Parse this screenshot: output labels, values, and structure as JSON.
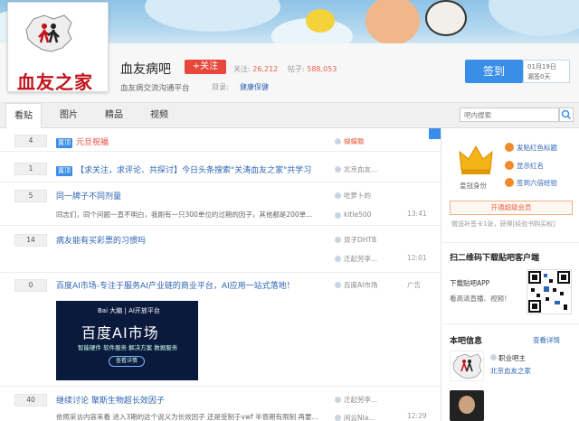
{
  "forum": {
    "name": "血友病吧",
    "follow_label": "+关注",
    "followers_label": "关注:",
    "followers_value": "26,212",
    "posts_label": "帖子:",
    "posts_value": "588,053",
    "description": "血友病交流沟通平台",
    "category_label": "目录:",
    "category_value": "健康保健",
    "logo_text": "血友之家"
  },
  "signin": {
    "button_label": "签到",
    "date": "01月19日",
    "days": "漏签0天"
  },
  "tabs": [
    {
      "label": "看贴",
      "active": true
    },
    {
      "label": "图片",
      "active": false
    },
    {
      "label": "精品",
      "active": false
    },
    {
      "label": "视频",
      "active": false
    }
  ],
  "search": {
    "placeholder": "吧内搜索"
  },
  "threads": [
    {
      "replies": "4",
      "tag": "置顶",
      "title": "元旦祝福",
      "author": "蝴蝶飘",
      "excerpt": "",
      "time": ""
    },
    {
      "replies": "1",
      "tag": "置顶",
      "title": "【求关注，求评论、共探讨】今日头条搜索\"关涛血友之家\"共学习",
      "author": "北京血友...",
      "excerpt": "",
      "time": ""
    },
    {
      "replies": "5",
      "tag": "",
      "title": "同一牌子不同剂量",
      "author": "吃萝卜的",
      "excerpt": "同志们，同个问题一直不明白，我刚有一只300单位的过期的因子，其他都是200单...",
      "last": "kitle500",
      "time": "13:41"
    },
    {
      "replies": "14",
      "tag": "",
      "title": "病友能有买彩票的习惯吗",
      "author": "双子DHTB",
      "excerpt": "",
      "last": "迁起劳李...",
      "time": "12:01"
    },
    {
      "replies": "0",
      "tag": "",
      "title": "百度AI市场-专注于服务AI产业链的商业平台，AI应用一站式落地！",
      "author": "百度AI市场",
      "excerpt": "",
      "time": "广告"
    },
    {
      "replies": "40",
      "tag": "",
      "title": "继续讨论 聚斯生物超长效因子",
      "author": "迁起劳李...",
      "excerpt": "依照采访内容来看 进入3期的这个说义为长效因子 还是受制于vwf 半衰期有限制 再要...",
      "last": "闲云Nla...",
      "time": "12:29"
    }
  ],
  "ad": {
    "brand": "Bai 大脑 | AI开放平台",
    "title": "百度AI市场",
    "subtitle": "智能硬件 软件服务 解决方案 数据服务",
    "button": "查看详情"
  },
  "sidebar": {
    "badge_label": "皇冠身份",
    "perks": [
      "发贴红色标题",
      "显示红名",
      "签到六倍经验"
    ],
    "member_button": "开通超级会员",
    "member_note": "赠送补签卡1张，获得[经验书购买权]",
    "app_title": "扫二维码下载贴吧客户端",
    "app_lines": [
      "下载贴吧APP",
      "看高清直播、视频！"
    ],
    "info_title": "本吧信息",
    "info_link": "查看详情",
    "owner_label": "职业吧主",
    "owner_name": "北京血友之家"
  },
  "colors": {
    "accent": "#3a8ee8",
    "follow": "#e8483c",
    "link": "#2d64b3"
  }
}
